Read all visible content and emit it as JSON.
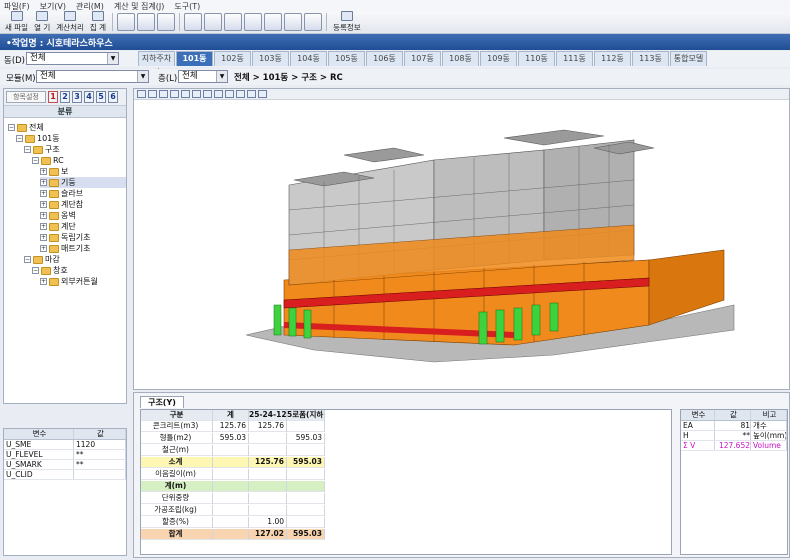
{
  "menu": [
    "파일(F)",
    "보기(V)",
    "관리(M)",
    "계산 및 집계(J)",
    "도구(T)"
  ],
  "toolbar": {
    "left": [
      {
        "label": "새 파일",
        "icon": "new-file-icon"
      },
      {
        "label": "열 기",
        "icon": "open-folder-icon"
      },
      {
        "label": "계산처리",
        "icon": "calculate-icon"
      },
      {
        "label": "집 계",
        "icon": "sum-icon"
      }
    ],
    "right_label": "등록정보"
  },
  "title": "•작업명 : 시호테라스하우스",
  "dong": {
    "label": "동(D):",
    "value": "전체"
  },
  "buildings": [
    "지하주차장",
    "101동",
    "102동",
    "103동",
    "104동",
    "105동",
    "106동",
    "107동",
    "108동",
    "109동",
    "110동",
    "111동",
    "112동",
    "113동",
    "통합모델"
  ],
  "active_building": "101동",
  "module": {
    "label": "모듈(M):",
    "value": "전체"
  },
  "floor": {
    "label": "층(L):",
    "value": "전체"
  },
  "path": "전체 > 101동 > 구조 > RC",
  "tree": {
    "settings_button": "항목설정",
    "levels": [
      "1",
      "2",
      "3",
      "4",
      "5",
      "6"
    ],
    "header": "분류",
    "nodes": [
      {
        "label": "전체",
        "depth": 0
      },
      {
        "label": "101동",
        "depth": 1
      },
      {
        "label": "구조",
        "depth": 2
      },
      {
        "label": "RC",
        "depth": 3
      },
      {
        "label": "보",
        "depth": 4
      },
      {
        "label": "기둥",
        "depth": 4
      },
      {
        "label": "슬라브",
        "depth": 4
      },
      {
        "label": "계단참",
        "depth": 4
      },
      {
        "label": "옹벽",
        "depth": 4
      },
      {
        "label": "계단",
        "depth": 4
      },
      {
        "label": "독립기초",
        "depth": 4
      },
      {
        "label": "매트기초",
        "depth": 4
      },
      {
        "label": "마감",
        "depth": 2
      },
      {
        "label": "창호",
        "depth": 3
      },
      {
        "label": "외부커튼월",
        "depth": 4
      }
    ],
    "selected": "기둥"
  },
  "vars": {
    "headers": [
      "변수",
      "값"
    ],
    "rows": [
      [
        "U_SME",
        "1120"
      ],
      [
        "U_FLEVEL",
        "**"
      ],
      [
        "U_SMARK",
        "**"
      ],
      [
        "U_CLID",
        ""
      ]
    ]
  },
  "bottom": {
    "tab": "구조(Y)",
    "headers": [
      "구분",
      "계",
      "25-24-12",
      "5로폼(지하)"
    ],
    "rows": [
      {
        "name": "콘크리트(m3)",
        "total": "125.76",
        "c1": "125.76",
        "c2": "",
        "style": ""
      },
      {
        "name": "형틀(m2)",
        "total": "595.03",
        "c1": "",
        "c2": "595.03",
        "style": ""
      },
      {
        "name": "철근(m)",
        "total": "",
        "c1": "",
        "c2": "",
        "style": ""
      },
      {
        "name": "소계",
        "total": "",
        "c1": "125.76",
        "c2": "595.03",
        "style": "yellow"
      },
      {
        "name": "이음길이(m)",
        "total": "",
        "c1": "",
        "c2": "",
        "style": ""
      },
      {
        "name": "계(m)",
        "total": "",
        "c1": "",
        "c2": "",
        "style": "green"
      },
      {
        "name": "단위중량",
        "total": "",
        "c1": "",
        "c2": "",
        "style": ""
      },
      {
        "name": "가공조립(kg)",
        "total": "",
        "c1": "",
        "c2": "",
        "style": ""
      },
      {
        "name": "할증(%)",
        "total": "",
        "c1": "1.00",
        "c2": "",
        "style": ""
      },
      {
        "name": "합계",
        "total": "",
        "c1": "127.02",
        "c2": "595.03",
        "style": "orange"
      }
    ]
  },
  "right_table": {
    "headers": [
      "변수",
      "값",
      "비고"
    ],
    "rows": [
      [
        "EA",
        "81",
        "개수"
      ],
      [
        "H",
        "**",
        "높이(mm)"
      ],
      [
        "Σ V",
        "127.652",
        "Volume"
      ]
    ]
  },
  "colors": {
    "title_bar": "#2a5aa6",
    "active_tab": "#3b6fb9",
    "concrete": "#f08a1c",
    "column": "#3fd23f",
    "beam": "#d81e1e",
    "yellow_row": "#fdf7b3",
    "green_row": "#d6f0c4",
    "orange_row": "#f8d5b0"
  }
}
